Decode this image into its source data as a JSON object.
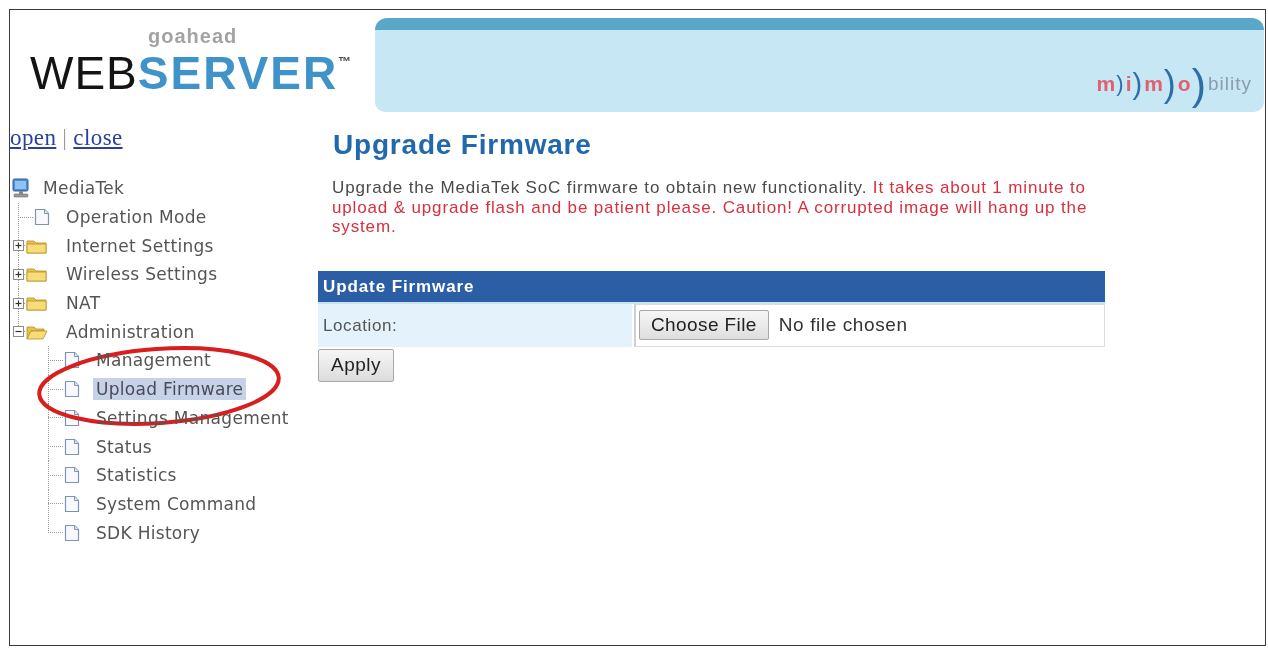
{
  "header": {
    "logo": {
      "tagline": "goahead",
      "parts": [
        {
          "text": "WEB",
          "kind": "dark"
        },
        {
          "text": "SERVER",
          "kind": "accent"
        },
        {
          "text": "™",
          "kind": "mark"
        }
      ]
    },
    "banner": {
      "logo_parts": [
        {
          "text": "m",
          "kind": "accent"
        },
        {
          "text": ")",
          "kind": "arc"
        },
        {
          "text": "i",
          "kind": "accent"
        },
        {
          "text": ")",
          "kind": "arc"
        },
        {
          "text": "m",
          "kind": "accent"
        },
        {
          "text": ")",
          "kind": "arc"
        },
        {
          "text": "o",
          "kind": "accent"
        },
        {
          "text": ")",
          "kind": "arc"
        },
        {
          "text": "bility",
          "kind": "plain"
        }
      ]
    }
  },
  "sidebar": {
    "links": [
      {
        "label": "open"
      },
      {
        "label": "close"
      }
    ],
    "separator": "|",
    "tree": [
      {
        "label": "MediaTek",
        "kind": "computer",
        "selected": false,
        "children": [
          {
            "label": "Operation Mode",
            "kind": "page",
            "selected": false
          },
          {
            "label": "Internet Settings",
            "kind": "folder",
            "expanded": false,
            "selected": false
          },
          {
            "label": "Wireless Settings",
            "kind": "folder",
            "expanded": false,
            "selected": false
          },
          {
            "label": "NAT",
            "kind": "folder",
            "expanded": false,
            "selected": false
          },
          {
            "label": "Administration",
            "kind": "folder",
            "expanded": true,
            "selected": false,
            "children": [
              {
                "label": "Management",
                "kind": "page",
                "selected": false
              },
              {
                "label": "Upload Firmware",
                "kind": "page",
                "selected": true
              },
              {
                "label": "Settings Management",
                "kind": "page",
                "selected": false
              },
              {
                "label": "Status",
                "kind": "page",
                "selected": false
              },
              {
                "label": "Statistics",
                "kind": "page",
                "selected": false
              },
              {
                "label": "System Command",
                "kind": "page",
                "selected": false
              },
              {
                "label": "SDK History",
                "kind": "page",
                "selected": false
              }
            ]
          }
        ]
      }
    ]
  },
  "annotation": {
    "kind": "ellipse"
  },
  "main": {
    "title": "Upgrade Firmware",
    "intro": [
      {
        "text": "Upgrade the MediaTek SoC firmware to obtain new functionality.",
        "kind": "normal"
      },
      {
        "text": "It takes about 1 minute to upload & upgrade flash and be patient please. Caution! A corrupted image will hang up the system.",
        "kind": "warning"
      }
    ],
    "form": {
      "header": "Update Firmware",
      "rows": [
        {
          "label": "Location:",
          "button": "Choose File",
          "status": "No file chosen"
        }
      ]
    },
    "apply_button": "Apply"
  }
}
